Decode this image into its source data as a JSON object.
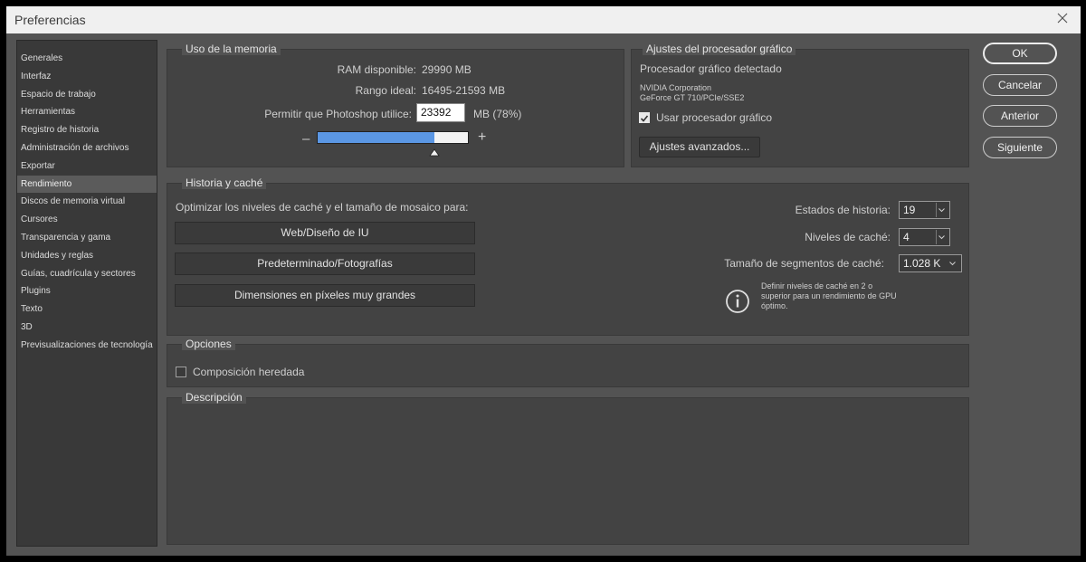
{
  "window": {
    "title": "Preferencias"
  },
  "sidebar": {
    "items": [
      "Generales",
      "Interfaz",
      "Espacio de trabajo",
      "Herramientas",
      "Registro de historia",
      "Administración de archivos",
      "Exportar",
      "Rendimiento",
      "Discos de memoria virtual",
      "Cursores",
      "Transparencia y gama",
      "Unidades y reglas",
      "Guías, cuadrícula y sectores",
      "Plugins",
      "Texto",
      "3D",
      "Previsualizaciones de tecnología"
    ],
    "active": "Rendimiento"
  },
  "memory": {
    "title": "Uso de la memoria",
    "ram_label": "RAM disponible:",
    "ram_value": "29990 MB",
    "ideal_label": "Rango ideal:",
    "ideal_value": "16495-21593 MB",
    "allow_label": "Permitir que Photoshop utilice:",
    "allow_value": "23392",
    "allow_unit": "MB (78%)",
    "minus": "–",
    "plus": "+",
    "usage_fraction": 0.78
  },
  "gpu": {
    "title": "Ajustes del procesador gráfico",
    "detected_label": "Procesador gráfico detectado",
    "vendor": "NVIDIA Corporation",
    "model": "GeForce GT 710/PCIe/SSE2",
    "use_gpu_label": "Usar procesador gráfico",
    "use_gpu_checked": true,
    "advanced_button": "Ajustes avanzados..."
  },
  "cache": {
    "title": "Historia y caché",
    "optimize_label": "Optimizar los niveles de caché y el tamaño de mosaico para:",
    "presets": [
      "Web/Diseño de IU",
      "Predeterminado/Fotografías",
      "Dimensiones en píxeles muy grandes"
    ],
    "history_label": "Estados de historia:",
    "history_value": "19",
    "levels_label": "Niveles de caché:",
    "levels_value": "4",
    "tile_label": "Tamaño de segmentos de caché:",
    "tile_value": "1.028 K",
    "info_text_1": "Definir niveles de caché en 2 o",
    "info_text_2": "superior para un rendimiento de GPU",
    "info_text_3": "óptimo."
  },
  "options": {
    "title": "Opciones",
    "legacy_label": "Composición heredada",
    "legacy_checked": false
  },
  "description": {
    "title": "Descripción"
  },
  "buttons": {
    "ok": "OK",
    "cancel": "Cancelar",
    "prev": "Anterior",
    "next": "Siguiente"
  }
}
